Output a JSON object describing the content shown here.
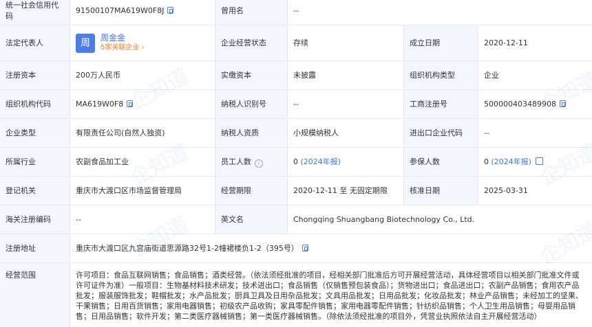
{
  "watermark": "企知道",
  "rows": {
    "credit_code": {
      "label": "统一社会信用代码",
      "value": "91500107MA619W0F8J"
    },
    "former_name": {
      "label": "曾用名",
      "value": "--"
    },
    "legal_rep": {
      "label": "法定代表人",
      "avatar": "周",
      "name": "周金金",
      "sub": "5家关联企业 ›"
    },
    "biz_status": {
      "label": "企业经营状态",
      "value": "存续"
    },
    "est_date": {
      "label": "成立日期",
      "value": "2020-12-11"
    },
    "reg_capital": {
      "label": "注册资本",
      "value": "200万人民币"
    },
    "paid_capital": {
      "label": "实缴资本",
      "value": "未披露"
    },
    "org_type": {
      "label": "组织机构类型",
      "value": "企业"
    },
    "org_code": {
      "label": "组织机构代码",
      "value": "MA619W0F8"
    },
    "taxpayer_id": {
      "label": "纳税人识别号",
      "value": "--"
    },
    "biz_reg_no": {
      "label": "工商注册号",
      "value": "500000403489908"
    },
    "company_type": {
      "label": "企业类型",
      "value": "有限责任公司(自然人独资)"
    },
    "taxpayer_qual": {
      "label": "纳税人资质",
      "value": "小规模纳税人"
    },
    "import_export": {
      "label": "进出口企业代码",
      "value": "--"
    },
    "industry": {
      "label": "所属行业",
      "value": "农副食品加工业"
    },
    "staff": {
      "label": "员工人数",
      "value": "0",
      "link": "(2024年报)"
    },
    "insured": {
      "label": "参保人数",
      "value": "0",
      "link": "(2024年报)"
    },
    "reg_authority": {
      "label": "登记机关",
      "value": "重庆市大渡口区市场监督管理局"
    },
    "biz_term": {
      "label": "经营期限",
      "value": "2020-12-11 至 无固定期限"
    },
    "approval_date": {
      "label": "核准日期",
      "value": "2025-03-31"
    },
    "customs_code": {
      "label": "海关注册编码",
      "value": "--"
    },
    "english_name": {
      "label": "英文名",
      "value": "Chongqing Shuangbang Biotechnology Co., Ltd."
    },
    "reg_address": {
      "label": "注册地址",
      "value": "重庆市大渡口区九宫庙街道思源路32号1-2幢裙楼负1-2（395号）"
    },
    "biz_scope": {
      "label": "经营范围",
      "value": "许可项目：食品互联网销售；食品销售；酒类经营。（依法须经批准的项目，经相关部门批准后方可开展经营活动，具体经营项目以相关部门批准文件或许可证件为准）一般项目：生物基材料技术研发；技术进出口；食品销售（仅销售预包装食品）；货物进出口；食品进出口；农副产品销售；食用农产品批发；服装服饰批发；鞋帽批发；水产品批发；厨具卫具及日用杂品批发；文具用品批发；日用品批发；化妆品批发；林业产品销售；未经加工的坚果、干果销售；日用百货销售；家用电器销售；初级农产品收购；家具零配件销售；家用电器零配件销售；针纺织品销售；个人卫生用品销售；母婴用品销售；日用品销售；软件开发；第二类医疗器械销售；第一类医疗器械销售。（除依法须经批准的项目外，凭营业执照依法自主开展经营活动）"
    }
  }
}
